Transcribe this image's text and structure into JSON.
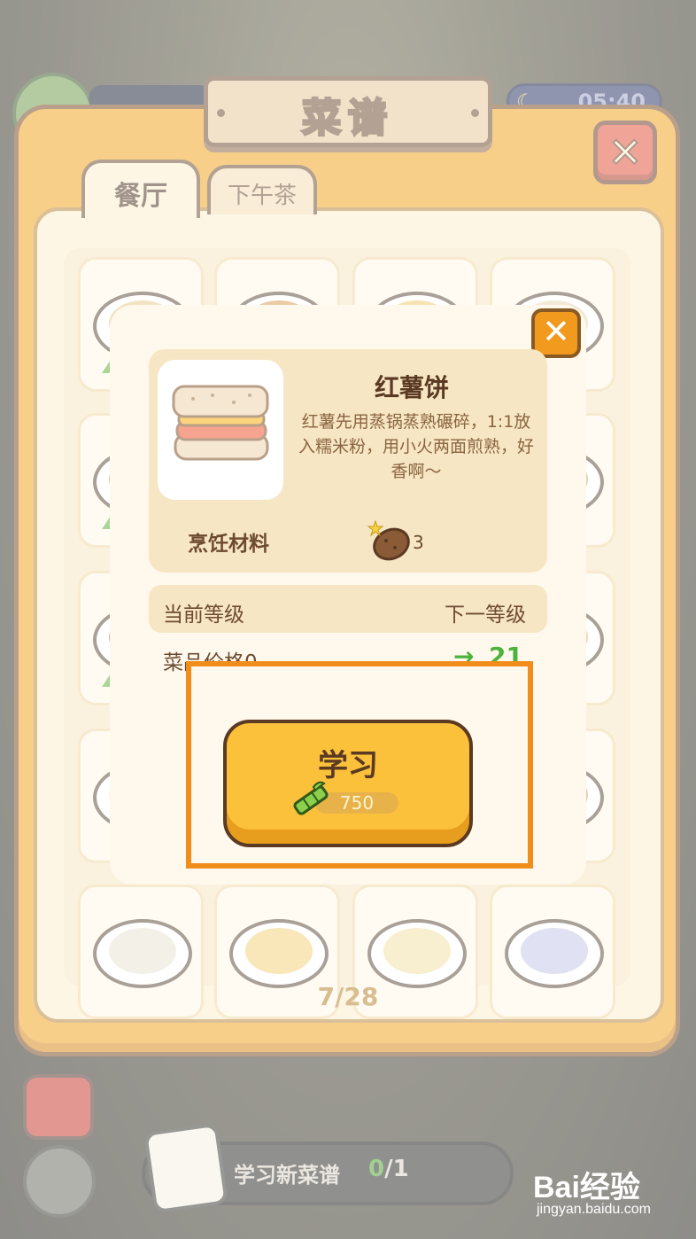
{
  "hud": {
    "timer": "05:40"
  },
  "recipe_book": {
    "title": "菜谱",
    "tabs": [
      {
        "label": "餐厅",
        "active": true
      },
      {
        "label": "下午茶",
        "active": false
      }
    ],
    "page_count": "7/28"
  },
  "dialog": {
    "dish_name": "红薯饼",
    "description": "红薯先用蒸锅蒸熟碾碎，1:1放入糯米粉，用小火两面煎熟，好香啊～",
    "materials_label": "烹饪材料",
    "material_count": "3",
    "current_level_label": "当前等级",
    "next_level_label": "下一等级",
    "price_label": "菜品价格0",
    "price_arrow": "→",
    "price_next": "21",
    "learn_button": "学习",
    "learn_cost": "750"
  },
  "bottom_bar": {
    "quest_label": "学习新菜谱",
    "quest_done": "0",
    "quest_total": "/1"
  },
  "watermark": {
    "logo": "Bai经验",
    "url": "jingyan.baidu.com"
  },
  "colors": {
    "panel_orange": "#f2a31d",
    "button_yellow": "#fcc13b",
    "highlight_orange": "#f08d1b",
    "price_green": "#4bb23a"
  }
}
